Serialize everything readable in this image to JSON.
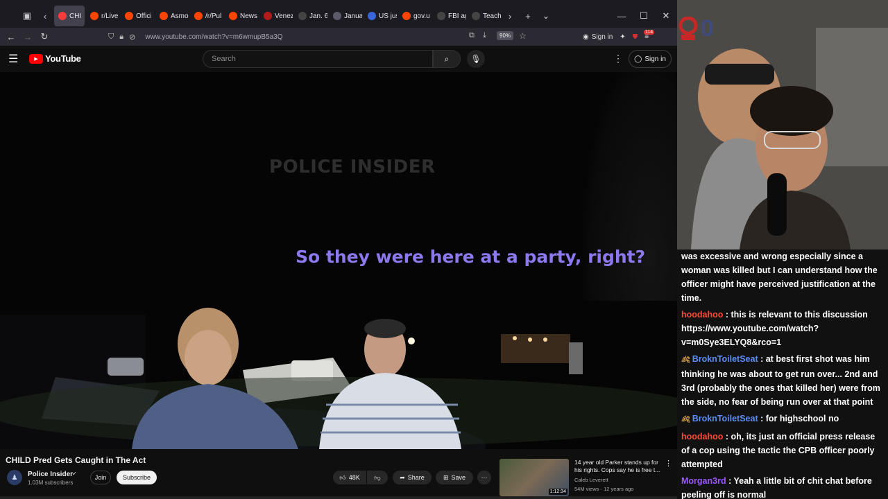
{
  "browser": {
    "tabs": [
      {
        "label": "CHI",
        "active": true,
        "color": "#ff3b3b"
      },
      {
        "label": "r/Live",
        "color": "#ff4500"
      },
      {
        "label": "Offici",
        "color": "#ff4500"
      },
      {
        "label": "Asmo",
        "color": "#ff4500"
      },
      {
        "label": "/r/Pul",
        "color": "#ff4500"
      },
      {
        "label": "News",
        "color": "#ff4500"
      },
      {
        "label": "Venez",
        "color": "#b31b1b"
      },
      {
        "label": "Jan. 6",
        "color": "#444444"
      },
      {
        "label": "Januar",
        "color": "#5a5a6a"
      },
      {
        "label": "US jus",
        "color": "#3a66d9"
      },
      {
        "label": "gov.u",
        "color": "#ff4500"
      },
      {
        "label": "FBI ag",
        "color": "#444444"
      },
      {
        "label": "Teach",
        "color": "#444444"
      }
    ],
    "url": "www.youtube.com/watch?v=m6wmupB5a3Q",
    "zoom": "90%",
    "sign_in": "Sign in",
    "extension_badge": "114"
  },
  "youtube": {
    "logo_text": "YouTube",
    "search_placeholder": "Search",
    "sign_in": "Sign in"
  },
  "video": {
    "watermark": "POLICE INSIDER",
    "subtitle": "So they were here at a party, right?",
    "title": "CHILD Pred Gets Caught in The Act",
    "channel": "Police Insider",
    "subscribers": "1.03M subscribers",
    "join": "Join",
    "subscribe": "Subscribe",
    "likes": "48K",
    "share": "Share",
    "save": "Save"
  },
  "recommendation": {
    "title": "14 year old Parker stands up for his rights. Cops say he is free t...",
    "channel": "Caleb Leverett",
    "meta": "54M views · 12 years ago",
    "duration": "1:12:34"
  },
  "webcam": {
    "overlay_text": "0"
  },
  "chat": [
    {
      "user": "",
      "color": "#ffffff",
      "text": "was excessive and wrong especially since a woman was killed but I can understand how the officer might have perceived justification at the time."
    },
    {
      "user": "hoodahoo",
      "color": "#ff4a3a",
      "text": "this is relevant to this discussion https://www.youtube.com/watch?v=m0Sye3ELYQ8&rco=1"
    },
    {
      "user": "BroknToiletSeat",
      "color": "#5c8df6",
      "badge": true,
      "text": "at best first shot was him thinking he was about to get run over... 2nd and 3rd (probably the ones that killed her) were from the side, no fear of being run over at that point"
    },
    {
      "user": "BroknToiletSeat",
      "color": "#5c8df6",
      "badge": true,
      "text": "for highschool no"
    },
    {
      "user": "hoodahoo",
      "color": "#ff4a3a",
      "text": "oh, its just an official press release of a cop using the tactic the CPB officer poorly attempted"
    },
    {
      "user": "Morgan3rd",
      "color": "#9b59ff",
      "text": "Yeah a little bit of chit chat before peeling off is normal"
    }
  ]
}
